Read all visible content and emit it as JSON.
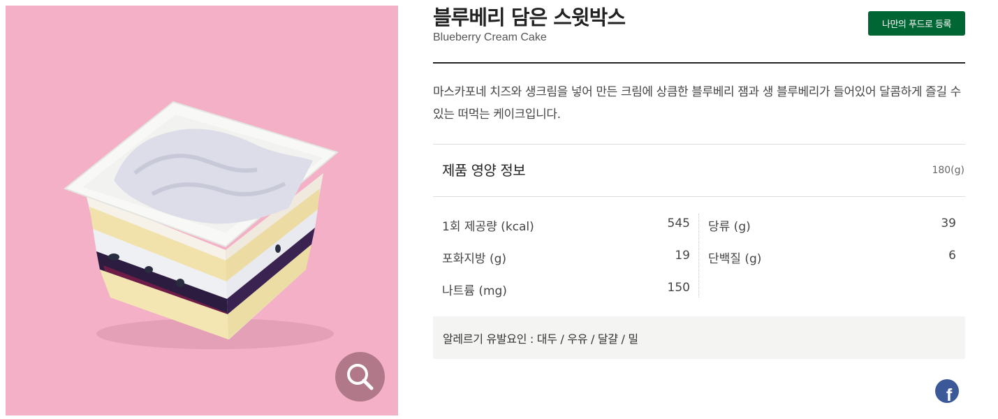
{
  "product": {
    "title": "블루베리 담은 스윗박스",
    "subtitle": "Blueberry Cream Cake",
    "register_label": "나만의 푸드로 등록",
    "description": "마스카포네 치즈와 생크림을 넣어 만든 크림에 상큼한 블루베리 잼과 생 블루베리가 들어있어 달콤하게 즐길 수 있는 떠먹는 케이크입니다.",
    "image_icon": "zoom-magnifier-icon"
  },
  "nutrition": {
    "title": "제품 영양 정보",
    "weight": "180(g)",
    "left": [
      {
        "label": "1회 제공량 (kcal)",
        "value": "545"
      },
      {
        "label": "포화지방 (g)",
        "value": "19"
      },
      {
        "label": "나트륨 (mg)",
        "value": "150"
      }
    ],
    "right": [
      {
        "label": "당류 (g)",
        "value": "39"
      },
      {
        "label": "단백질 (g)",
        "value": "6"
      }
    ]
  },
  "allergy": {
    "text": "알레르기 유발요인 : 대두 / 우유 / 달걀 / 밀"
  },
  "share": {
    "facebook_glyph": "f",
    "icon": "facebook-icon"
  },
  "colors": {
    "brand_green": "#006633",
    "image_bg": "#f3b0c6",
    "facebook": "#3b5998"
  }
}
